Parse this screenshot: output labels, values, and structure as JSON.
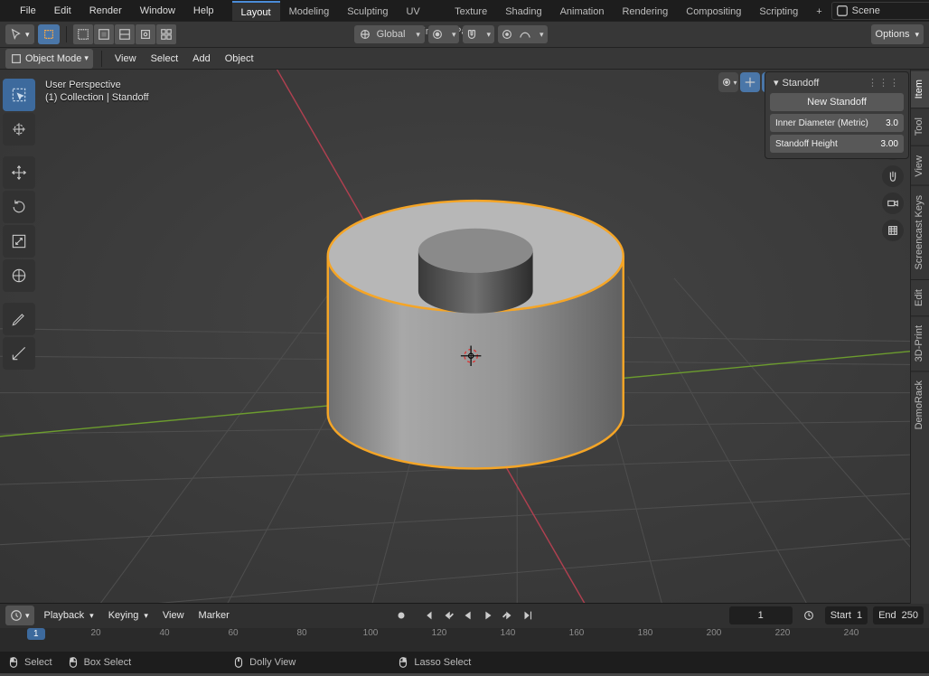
{
  "menubar": {
    "items": [
      "File",
      "Edit",
      "Render",
      "Window",
      "Help"
    ]
  },
  "workspaces": {
    "tabs": [
      "Layout",
      "Modeling",
      "Sculpting",
      "UV Editing",
      "Texture Paint",
      "Shading",
      "Animation",
      "Rendering",
      "Compositing",
      "Scripting"
    ],
    "active": "Layout",
    "add": "+"
  },
  "scene": {
    "label": "Scene"
  },
  "toolhdr1": {
    "orientation": "Global",
    "options": "Options"
  },
  "toolhdr2": {
    "mode": "Object Mode",
    "menus": [
      "View",
      "Select",
      "Add",
      "Object"
    ]
  },
  "viewport": {
    "line1": "User Perspective",
    "line2": "(1) Collection | Standoff"
  },
  "right_tabs": [
    "Item",
    "Tool",
    "View",
    "Screencast Keys",
    "Edit",
    "3D-Print",
    "DemoRack"
  ],
  "operator": {
    "title": "Standoff",
    "new_label": "New Standoff",
    "rows": [
      {
        "label": "Inner Diameter (Metric)",
        "value": "3.0"
      },
      {
        "label": "Standoff Height",
        "value": "3.00"
      }
    ]
  },
  "timeline": {
    "playback": "Playback",
    "keying": "Keying",
    "view": "View",
    "marker": "Marker",
    "current": "1",
    "start_label": "Start",
    "start": "1",
    "end_label": "End",
    "end": "250",
    "ticks": [
      "20",
      "40",
      "60",
      "80",
      "100",
      "120",
      "140",
      "160",
      "180",
      "200",
      "220",
      "240"
    ],
    "playhead": "1"
  },
  "statusbar": {
    "items": [
      {
        "icon": "mouse-left",
        "label": "Select"
      },
      {
        "icon": "mouse-left",
        "label": "Box Select"
      },
      {
        "icon": "mouse-middle",
        "label": "Dolly View"
      },
      {
        "icon": "mouse-right",
        "label": "Lasso Select"
      }
    ]
  }
}
